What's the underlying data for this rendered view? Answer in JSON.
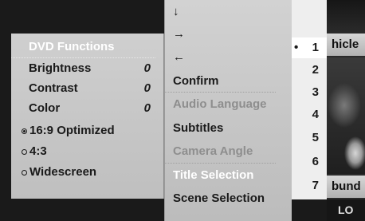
{
  "dvd_functions": {
    "title": "DVD Functions",
    "settings": [
      {
        "label": "Brightness",
        "value": "0"
      },
      {
        "label": "Contrast",
        "value": "0"
      },
      {
        "label": "Color",
        "value": "0"
      }
    ],
    "aspect_options": [
      {
        "label": "16:9 Optimized",
        "selected": true
      },
      {
        "label": "4:3",
        "selected": false
      },
      {
        "label": "Widescreen",
        "selected": false
      }
    ]
  },
  "menu": {
    "nav_down": "↓",
    "nav_right": "→",
    "nav_left": "←",
    "confirm": "Confirm",
    "audio_language": "Audio Language",
    "subtitles": "Subtitles",
    "camera_angle": "Camera Angle",
    "title_selection": "Title Selection",
    "scene_selection": "Scene Selection"
  },
  "numbers": {
    "current_marker": "•",
    "items": [
      "1",
      "2",
      "3",
      "4",
      "5",
      "6",
      "7"
    ],
    "current_index": 0
  },
  "background": {
    "top_label": "hicle",
    "bottom_label": "bund",
    "status_label": "LO"
  },
  "colors": {
    "panel_bg": "#c8c8c8",
    "highlight_text": "#ffffff",
    "disabled_text": "#8e8e8e",
    "number_panel_bg": "#eeeeee"
  }
}
